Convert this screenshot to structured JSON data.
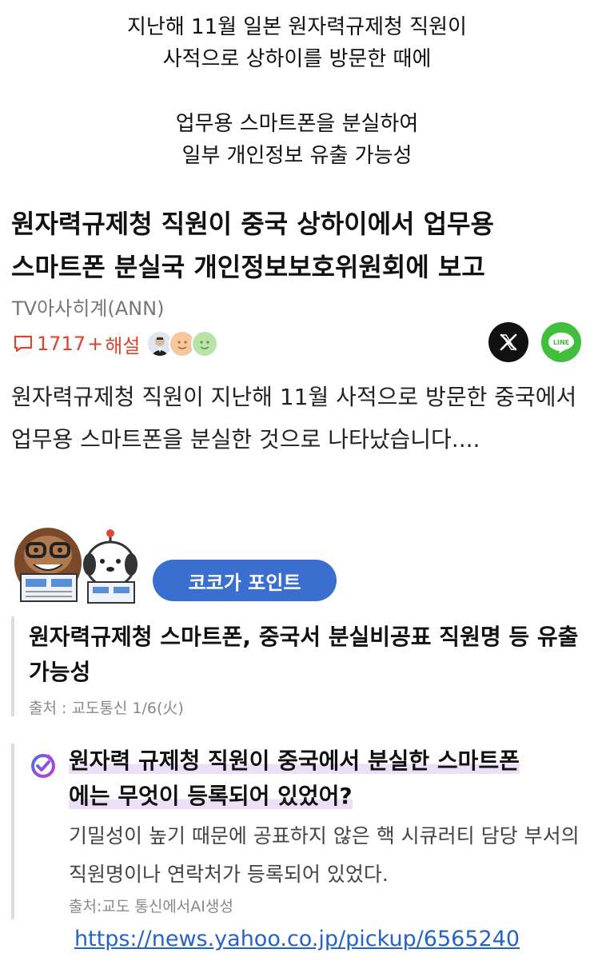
{
  "caption": {
    "line1": "지난해 11월 일본 원자력규제청 직원이",
    "line2": "사적으로 상하이를 방문한 때에",
    "line3": "업무용 스마트폰을 분실하여",
    "line4": "일부 개인정보 유출 가능성"
  },
  "article": {
    "headline_line1": "원자력규제청 직원이 중국 상하이에서 업무용",
    "headline_line2": "스마트폰 분실국 개인정보보호위원회에 보고",
    "source": "TV아사히계(ANN)",
    "comment_count": "1717",
    "comment_plus": "+",
    "comment_note": "해설",
    "summary": "원자력규제청 직원이 지난해 11월 사적으로 방문한 중국에서 업무용 스마트폰을 분실한 것으로 나타났습니다...."
  },
  "point": {
    "pill_label": "코코가 포인트",
    "title": "원자력규제청 스마트폰, 중국서 분실비공표 직원명 등 유출 가능성",
    "source": "출처 : 교도통신 1/6(火)"
  },
  "ai": {
    "question_line1": "원자력 규제청 직원이 중국에서 분실한 스마트폰",
    "question_line2": "에는 무엇이 등록되어 있었어?",
    "answer": "기밀성이 높기 때문에 공표하지 않은 핵 시큐러티 담당 부서의 직원명이나 연락처가 등록되어 있었다.",
    "source": "출처:교도 통신에서AI생성"
  },
  "url": "https://news.yahoo.co.jp/pickup/6565240",
  "share": {
    "line_label": "LINE"
  },
  "colors": {
    "accent_red": "#d9452f",
    "pill_blue": "#3a6fd0",
    "line_green": "#3fbf3b",
    "link_blue": "#2563c7"
  },
  "icons": [
    "comment-icon",
    "x-logo-icon",
    "line-logo-icon",
    "ai-check-icon",
    "mascot-gorilla",
    "mascot-robot-dog"
  ]
}
